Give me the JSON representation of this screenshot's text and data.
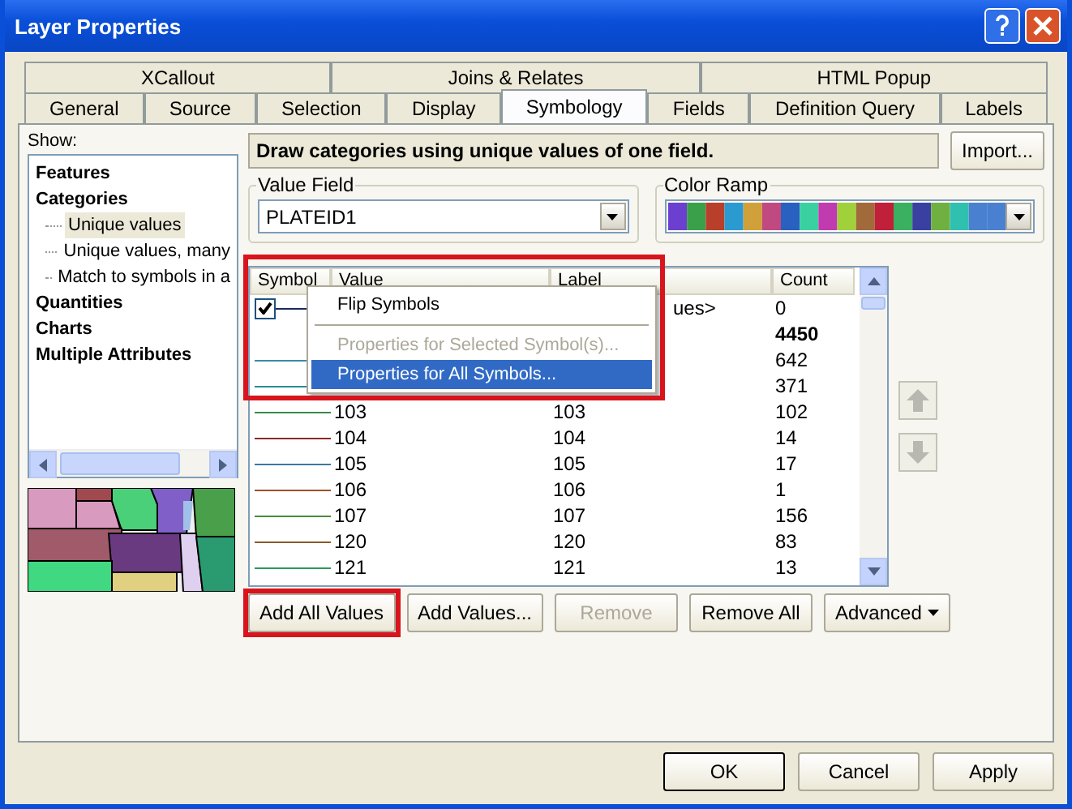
{
  "window": {
    "title": "Layer Properties"
  },
  "tabs_back": [
    {
      "label": "XCallout",
      "selected": false
    },
    {
      "label": "Joins & Relates",
      "selected": false
    },
    {
      "label": "HTML Popup",
      "selected": false
    }
  ],
  "tabs_front": [
    {
      "label": "General",
      "selected": false
    },
    {
      "label": "Source",
      "selected": false
    },
    {
      "label": "Selection",
      "selected": false
    },
    {
      "label": "Display",
      "selected": false
    },
    {
      "label": "Symbology",
      "selected": true
    },
    {
      "label": "Fields",
      "selected": false
    },
    {
      "label": "Definition Query",
      "selected": false
    },
    {
      "label": "Labels",
      "selected": false
    }
  ],
  "show_label": "Show:",
  "tree": [
    {
      "label": "Features",
      "selected": false
    },
    {
      "label": "Categories",
      "selected": false,
      "children": [
        {
          "label": "Unique values",
          "selected": true
        },
        {
          "label": "Unique values, many",
          "selected": false
        },
        {
          "label": "Match to symbols in a",
          "selected": false
        }
      ]
    },
    {
      "label": "Quantities",
      "selected": false
    },
    {
      "label": "Charts",
      "selected": false
    },
    {
      "label": "Multiple Attributes",
      "selected": false
    }
  ],
  "description": "Draw categories using unique values of one field.",
  "import_button": "Import...",
  "value_field": {
    "label": "Value Field",
    "value": "PLATEID1"
  },
  "color_ramp": {
    "label": "Color Ramp"
  },
  "table": {
    "columns": [
      "Symbol",
      "Value",
      "Label",
      "Count"
    ],
    "rows": [
      {
        "kind": "check",
        "checked": true,
        "color": "#1b2a5a",
        "label": "ues>",
        "count": "0"
      },
      {
        "kind": "heading",
        "count": "4450"
      },
      {
        "kind": "value",
        "color": "#3a8ab0",
        "count": "642"
      },
      {
        "kind": "value",
        "color": "#2a8a9a",
        "count": "371"
      },
      {
        "kind": "value",
        "color": "#3a8a4a",
        "value": "103",
        "label": "103",
        "count": "102"
      },
      {
        "kind": "value",
        "color": "#8a2a2a",
        "value": "104",
        "label": "104",
        "count": "14"
      },
      {
        "kind": "value",
        "color": "#3a7aa0",
        "value": "105",
        "label": "105",
        "count": "17"
      },
      {
        "kind": "value",
        "color": "#a0502a",
        "value": "106",
        "label": "106",
        "count": "1"
      },
      {
        "kind": "value",
        "color": "#4a8a3a",
        "value": "107",
        "label": "107",
        "count": "156"
      },
      {
        "kind": "value",
        "color": "#8a5a2a",
        "value": "120",
        "label": "120",
        "count": "83"
      },
      {
        "kind": "value",
        "color": "#2a9a5a",
        "value": "121",
        "label": "121",
        "count": "13"
      }
    ]
  },
  "context_menu": {
    "highlighted": true,
    "items": [
      {
        "kind": "item",
        "label": "Flip Symbols",
        "disabled": false,
        "selected": false
      },
      {
        "kind": "separator"
      },
      {
        "kind": "item",
        "label": "Properties for Selected Symbol(s)...",
        "disabled": true,
        "selected": false
      },
      {
        "kind": "item",
        "label": "Properties for All Symbols...",
        "disabled": false,
        "selected": true
      }
    ]
  },
  "buttons": [
    {
      "kind": "plain",
      "label": "Add All Values",
      "disabled": false,
      "highlighted": true
    },
    {
      "kind": "plain",
      "label": "Add Values...",
      "disabled": false,
      "highlighted": false
    },
    {
      "kind": "plain",
      "label": "Remove",
      "disabled": true,
      "highlighted": false
    },
    {
      "kind": "plain",
      "label": "Remove All",
      "disabled": false,
      "highlighted": false
    },
    {
      "kind": "menu",
      "label": "Advanced",
      "disabled": false,
      "highlighted": false
    }
  ],
  "dialog_buttons": [
    {
      "label": "OK",
      "default": true
    },
    {
      "label": "Cancel",
      "default": false
    },
    {
      "label": "Apply",
      "default": false
    }
  ]
}
